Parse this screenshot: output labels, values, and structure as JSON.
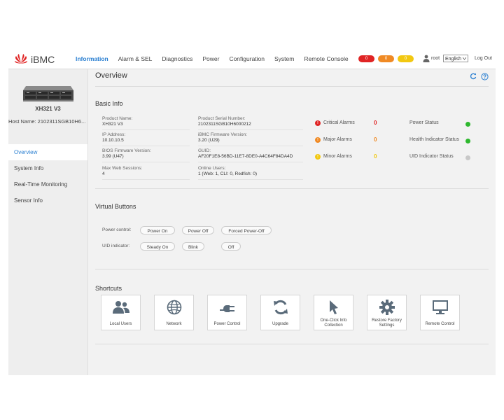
{
  "header": {
    "brand": "iBMC",
    "nav": [
      {
        "label": "Information",
        "active": true
      },
      {
        "label": "Alarm & SEL",
        "active": false
      },
      {
        "label": "Diagnostics",
        "active": false
      },
      {
        "label": "Power",
        "active": false
      },
      {
        "label": "Configuration",
        "active": false
      },
      {
        "label": "System",
        "active": false
      },
      {
        "label": "Remote Console",
        "active": false
      }
    ],
    "badges": [
      {
        "value": "0",
        "color": "#e02424"
      },
      {
        "value": "0",
        "color": "#f08a24"
      },
      {
        "value": "0",
        "color": "#f2c811"
      }
    ],
    "user": "root",
    "language": "English",
    "logout": "Log Out"
  },
  "sidebar": {
    "model": "XH321 V3",
    "host_name": "Host Name: 2102311SGB10H6...",
    "items": [
      {
        "label": "Overview",
        "active": true
      },
      {
        "label": "System Info",
        "active": false
      },
      {
        "label": "Real-Time Monitoring",
        "active": false
      },
      {
        "label": "Sensor Info",
        "active": false
      }
    ]
  },
  "main": {
    "title": "Overview",
    "basic_info": {
      "title": "Basic Info",
      "fields": {
        "product_name": {
          "label": "Product Name:",
          "value": "XH321 V3"
        },
        "serial_number": {
          "label": "Product Serial Number:",
          "value": "2102311SGB10H6000212"
        },
        "ip_address": {
          "label": "IP Address:",
          "value": "10.10.10.5"
        },
        "firmware_version": {
          "label": "iBMC Firmware Version:",
          "value": "3.20 (U29)"
        },
        "bios_version": {
          "label": "BIOS Firmware Version:",
          "value": "3.99 (U47)"
        },
        "guid": {
          "label": "GUID:",
          "value": "AF20F1E8-56BD-11E7-8DE0-A4C64F84DA4D"
        },
        "max_sessions": {
          "label": "Max Web Sessions:",
          "value": "4"
        },
        "online_users": {
          "label": "Online Users:",
          "value": "1 (Web: 1, CLI: 0, Redfish: 0)"
        }
      },
      "alarms": {
        "critical": {
          "label": "Critical Alarms",
          "count": "0",
          "color": "#e02424"
        },
        "major": {
          "label": "Major Alarms",
          "count": "0",
          "color": "#f08a24"
        },
        "minor": {
          "label": "Minor Alarms",
          "count": "0",
          "color": "#f2c811"
        }
      },
      "statuses": {
        "power": {
          "label": "Power Status",
          "color": "#2eb82e"
        },
        "health": {
          "label": "Health Indicator Status",
          "color": "#2eb82e"
        },
        "uid": {
          "label": "UID Indicator Status",
          "color": "#c8c8c8"
        }
      }
    },
    "virtual_buttons": {
      "title": "Virtual Buttons",
      "power_control_label": "Power control:",
      "power_on": "Power On",
      "power_off": "Power Off",
      "forced_power_off": "Forced Power-Off",
      "uid_label": "UID indicator:",
      "steady_on": "Steady On",
      "blink": "Blink",
      "off": "Off"
    },
    "shortcuts": {
      "title": "Shortcuts",
      "items": [
        {
          "label": "Local Users",
          "icon": "users-icon"
        },
        {
          "label": "Network",
          "icon": "globe-icon"
        },
        {
          "label": "Power Control",
          "icon": "plug-icon"
        },
        {
          "label": "Upgrade",
          "icon": "refresh-arrows-icon"
        },
        {
          "label": "One-Click Info Collection",
          "icon": "cursor-arrow-icon"
        },
        {
          "label": "Restore Factory Settings",
          "icon": "gear-icon"
        },
        {
          "label": "Remote Control",
          "icon": "monitor-icon"
        }
      ]
    }
  }
}
